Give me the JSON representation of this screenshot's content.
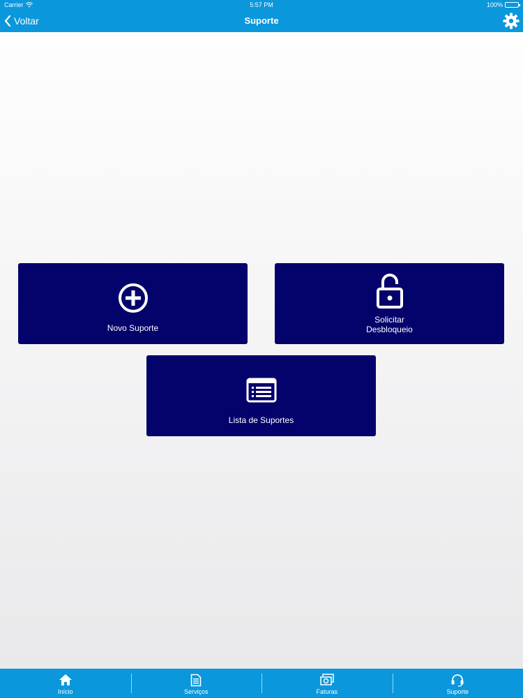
{
  "status_bar": {
    "carrier": "Carrier",
    "time": "5:57 PM",
    "battery": "100%"
  },
  "nav": {
    "back_label": "Voltar",
    "title": "Suporte",
    "settings_icon": "gear-icon"
  },
  "tiles": [
    {
      "label": "Novo Suporte",
      "icon": "plus-circle-icon"
    },
    {
      "label": "Solicitar\nDesbloqueio",
      "icon": "unlock-icon"
    },
    {
      "label": "Lista de Suportes",
      "icon": "list-icon"
    }
  ],
  "tabbar": {
    "tabs": [
      {
        "label": "Início",
        "icon": "home-icon"
      },
      {
        "label": "Serviços",
        "icon": "document-icon"
      },
      {
        "label": "Faturas",
        "icon": "money-icon"
      },
      {
        "label": "Suporte",
        "icon": "headset-icon"
      }
    ]
  },
  "colors": {
    "primary_blue": "#0a97dc",
    "tile_navy": "#04036b",
    "background": "#f3f3f4"
  }
}
